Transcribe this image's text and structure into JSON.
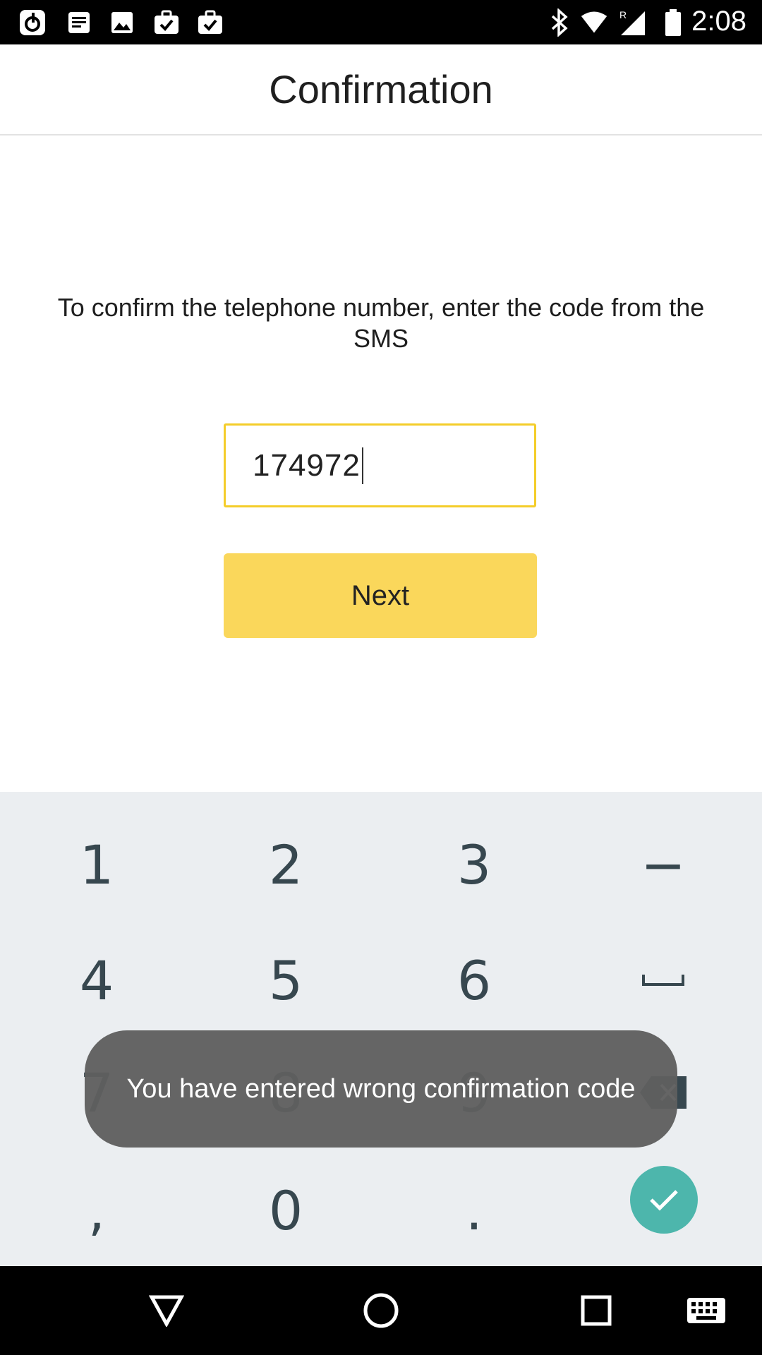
{
  "status_bar": {
    "time": "2:08",
    "left_icons": [
      "music-app-icon",
      "notes-icon",
      "image-icon",
      "briefcase-check-icon",
      "briefcase-check-icon"
    ],
    "right_icons": [
      "bluetooth-icon",
      "wifi-icon",
      "signal-roaming-icon",
      "battery-icon"
    ],
    "roaming_label": "R"
  },
  "app_bar": {
    "title": "Confirmation"
  },
  "content": {
    "instruction": "To confirm the telephone number, enter the code from the SMS",
    "code_value": "174972",
    "next_label": "Next"
  },
  "keyboard": {
    "keys": [
      "1",
      "2",
      "3",
      "−",
      "4",
      "5",
      "6",
      "␣",
      "7",
      "8",
      "9",
      "⌫",
      ",",
      "0",
      "."
    ],
    "colors": {
      "background": "#ebeef1",
      "key_text": "#37474f",
      "done": "#4db6ac"
    }
  },
  "toast": {
    "message": "You have entered wrong confirmation code"
  },
  "colors": {
    "accent_border": "#f4cd2a",
    "button": "#fad75b"
  }
}
